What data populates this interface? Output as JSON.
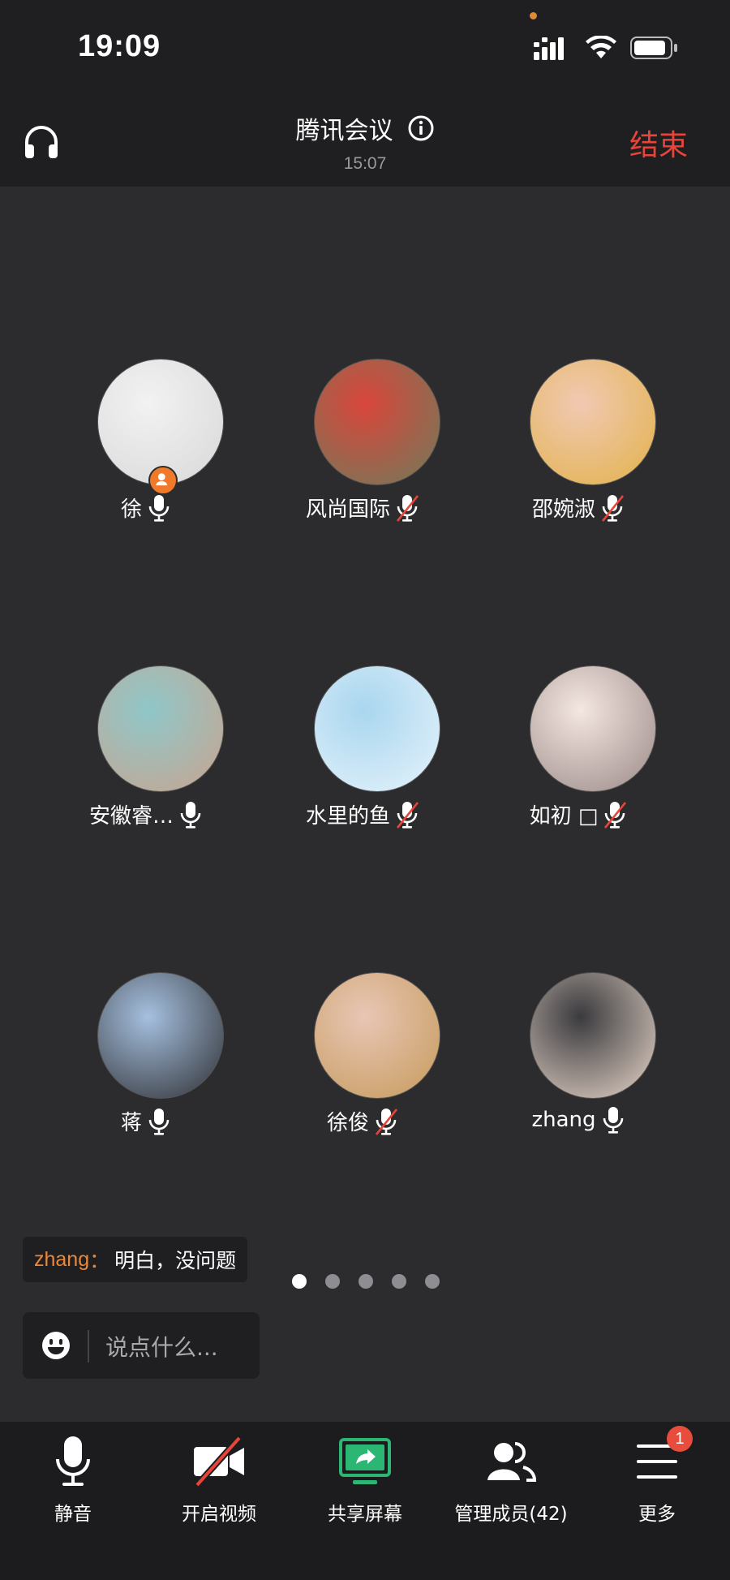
{
  "status_bar": {
    "time": "19:09"
  },
  "header": {
    "title": "腾讯会议",
    "duration": "15:07",
    "end_label": "结束"
  },
  "participants": [
    {
      "name": "徐",
      "mic": "on",
      "host": true,
      "avatar_colors": [
        "#f2f2f2",
        "#d8d8d8"
      ]
    },
    {
      "name": "风尚国际",
      "mic": "muted",
      "avatar_colors": [
        "#d9463b",
        "#6f7b5a"
      ]
    },
    {
      "name": "邵婉淑",
      "mic": "muted",
      "avatar_colors": [
        "#f1c9b3",
        "#e2b24a"
      ]
    },
    {
      "name": "安徽睿…",
      "mic": "on",
      "avatar_colors": [
        "#8fc7c9",
        "#c9a48f"
      ]
    },
    {
      "name": "水里的鱼",
      "mic": "muted",
      "avatar_colors": [
        "#a9d6ef",
        "#e6f3fb"
      ]
    },
    {
      "name": "如初 □",
      "mic": "muted",
      "avatar_colors": [
        "#f4e6e1",
        "#9b8a88"
      ]
    },
    {
      "name": "蒋",
      "mic": "on",
      "avatar_colors": [
        "#a5c0df",
        "#2f2f33"
      ]
    },
    {
      "name": "徐俊",
      "mic": "muted",
      "avatar_colors": [
        "#e8c6b5",
        "#c69a5b"
      ]
    },
    {
      "name": "zhang",
      "mic": "on",
      "avatar_colors": [
        "#3a3a3e",
        "#e8d6c9"
      ]
    }
  ],
  "chat": {
    "sender": "zhang",
    "colon": "：",
    "message": "明白，没问题",
    "placeholder": "说点什么..."
  },
  "pager": {
    "pages": 5,
    "active_index": 0
  },
  "toolbar": {
    "mute_label": "静音",
    "video_label": "开启视频",
    "share_label": "共享屏幕",
    "members_label": "管理成员(42)",
    "more_label": "更多",
    "more_badge": "1"
  },
  "colors": {
    "accent_end": "#e8443a",
    "share_green": "#2bb673",
    "chat_sender": "#e9883b"
  }
}
